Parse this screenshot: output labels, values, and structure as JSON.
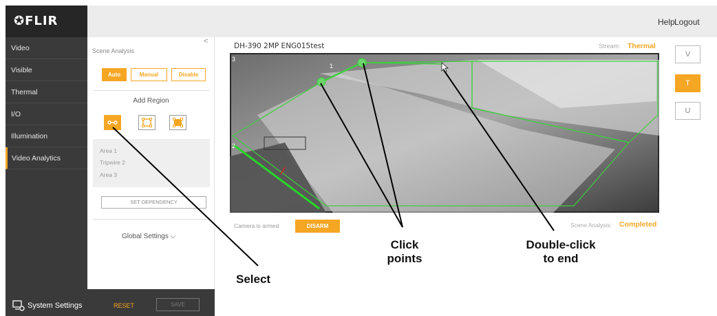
{
  "brand": {
    "logo_text": "FLIR"
  },
  "nav": {
    "items": [
      {
        "label": "Video"
      },
      {
        "label": "Visible"
      },
      {
        "label": "Thermal"
      },
      {
        "label": "I/O"
      },
      {
        "label": "Illumination"
      },
      {
        "label": "Video Analytics",
        "active": true
      }
    ],
    "system_settings": "System Settings"
  },
  "topbar": {
    "help": "Help",
    "logout": "Logout"
  },
  "panel": {
    "collapse_glyph": "<",
    "title": "Scene Analysis",
    "modes": [
      {
        "label": "Auto",
        "active": true
      },
      {
        "label": "Manual",
        "active": false
      },
      {
        "label": "Disable",
        "active": false
      }
    ],
    "add_region": "Add Region",
    "tools": [
      "tripwire-icon",
      "polygon-area-icon",
      "full-area-icon"
    ],
    "regions": [
      "Area 1",
      "Tripwire 2",
      "Area 3"
    ],
    "set_dependency": "SET DEPENDENCY",
    "global_settings": "Global Settings",
    "reset": "RESET",
    "save": "SAVE"
  },
  "video": {
    "camera_name": "DH-390 2MP ENG015test",
    "stream_label": "Stream:",
    "stream_value": "Thermal",
    "armed_text": "Camera is armed",
    "disarm": "DISARM",
    "scene_label": "Scene Analysis:",
    "scene_value": "Completed",
    "region_numbers": [
      "1",
      "2",
      "3"
    ]
  },
  "view_buttons": [
    {
      "label": "V",
      "active": false
    },
    {
      "label": "T",
      "active": true
    },
    {
      "label": "U",
      "active": false
    }
  ],
  "callouts": {
    "select": "Select",
    "click_points_1": "Click",
    "click_points_2": "points",
    "double_click_1": "Double-click",
    "double_click_2": "to end"
  },
  "colors": {
    "accent": "#f5a623",
    "region": "#3ecf3e",
    "nav_bg": "#3a3a3a"
  }
}
